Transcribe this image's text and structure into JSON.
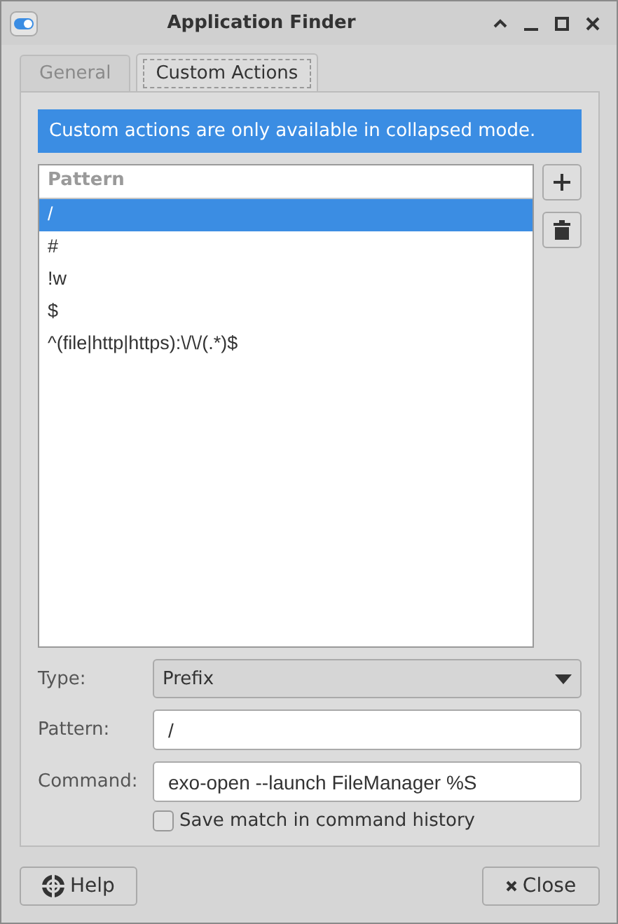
{
  "window": {
    "title": "Application Finder"
  },
  "tabs": [
    {
      "label": "General",
      "selected": false
    },
    {
      "label": "Custom Actions",
      "selected": true
    }
  ],
  "info_banner": "Custom actions are only available in collapsed mode.",
  "table": {
    "columns": [
      "Pattern"
    ],
    "rows": [
      {
        "pattern": "/",
        "selected": true
      },
      {
        "pattern": "#",
        "selected": false
      },
      {
        "pattern": "!w",
        "selected": false
      },
      {
        "pattern": "$",
        "selected": false
      },
      {
        "pattern": "^(file|http|https):\\/\\/(.*)$",
        "selected": false
      }
    ]
  },
  "form": {
    "type_label": "Type:",
    "type_value": "Prefix",
    "pattern_label": "Pattern:",
    "pattern_value": "/",
    "command_label": "Command:",
    "command_value": "exo-open --launch FileManager %S"
  },
  "save_history": {
    "label": "Save match in command history",
    "checked": false
  },
  "buttons": {
    "help": "Help",
    "close": "Close"
  }
}
